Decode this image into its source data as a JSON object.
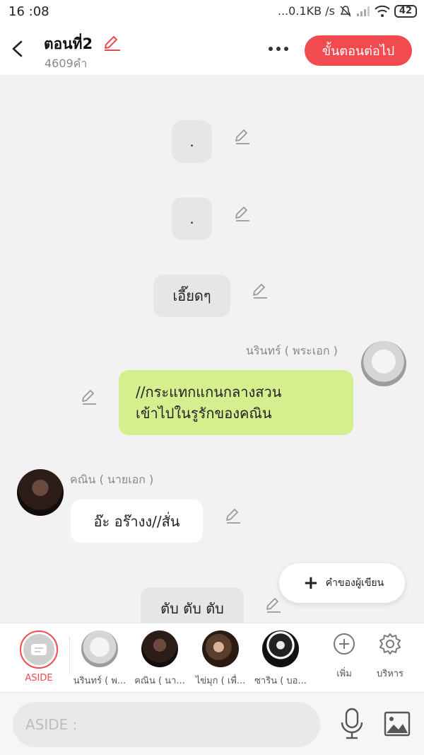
{
  "status_bar": {
    "time": "16 :08",
    "network_speed": "...0.1KB /s",
    "battery": "42"
  },
  "header": {
    "title": "ตอนที่2",
    "word_count": "4609คำ",
    "next_button": "ขั้นตอนต่อไป"
  },
  "messages": [
    {
      "type": "narration",
      "text": "."
    },
    {
      "type": "narration",
      "text": "."
    },
    {
      "type": "narration",
      "text": "เอี๊ยดๆ"
    },
    {
      "type": "right",
      "speaker": "นรินทร์ ( พระเอก )",
      "line1": "//กระแทกแกนกลางสวน",
      "line2": "เข้าไปในรูรักของคณิน"
    },
    {
      "type": "left",
      "speaker": "คณิน ( นายเอก )",
      "text": "อ๊ะ อร๊างง//สั่น"
    },
    {
      "type": "narration",
      "text": "ตับ ตับ ตับ"
    }
  ],
  "fab": {
    "label": "คำของผู้เขียน"
  },
  "character_bar": {
    "aside_label": "ASIDE",
    "characters": [
      {
        "name": "นรินทร์ ( พ..."
      },
      {
        "name": "คณิน ( นา..."
      },
      {
        "name": "ไข่มุก ( เพื่..."
      },
      {
        "name": "ซาริน ( บอ..."
      }
    ],
    "add_label": "เพิ่ม",
    "manage_label": "บริหาร"
  },
  "input": {
    "placeholder": "ASIDE :"
  },
  "colors": {
    "accent": "#f14a4f",
    "green_bubble": "#d5ee8e",
    "background": "#f2f2f2"
  }
}
